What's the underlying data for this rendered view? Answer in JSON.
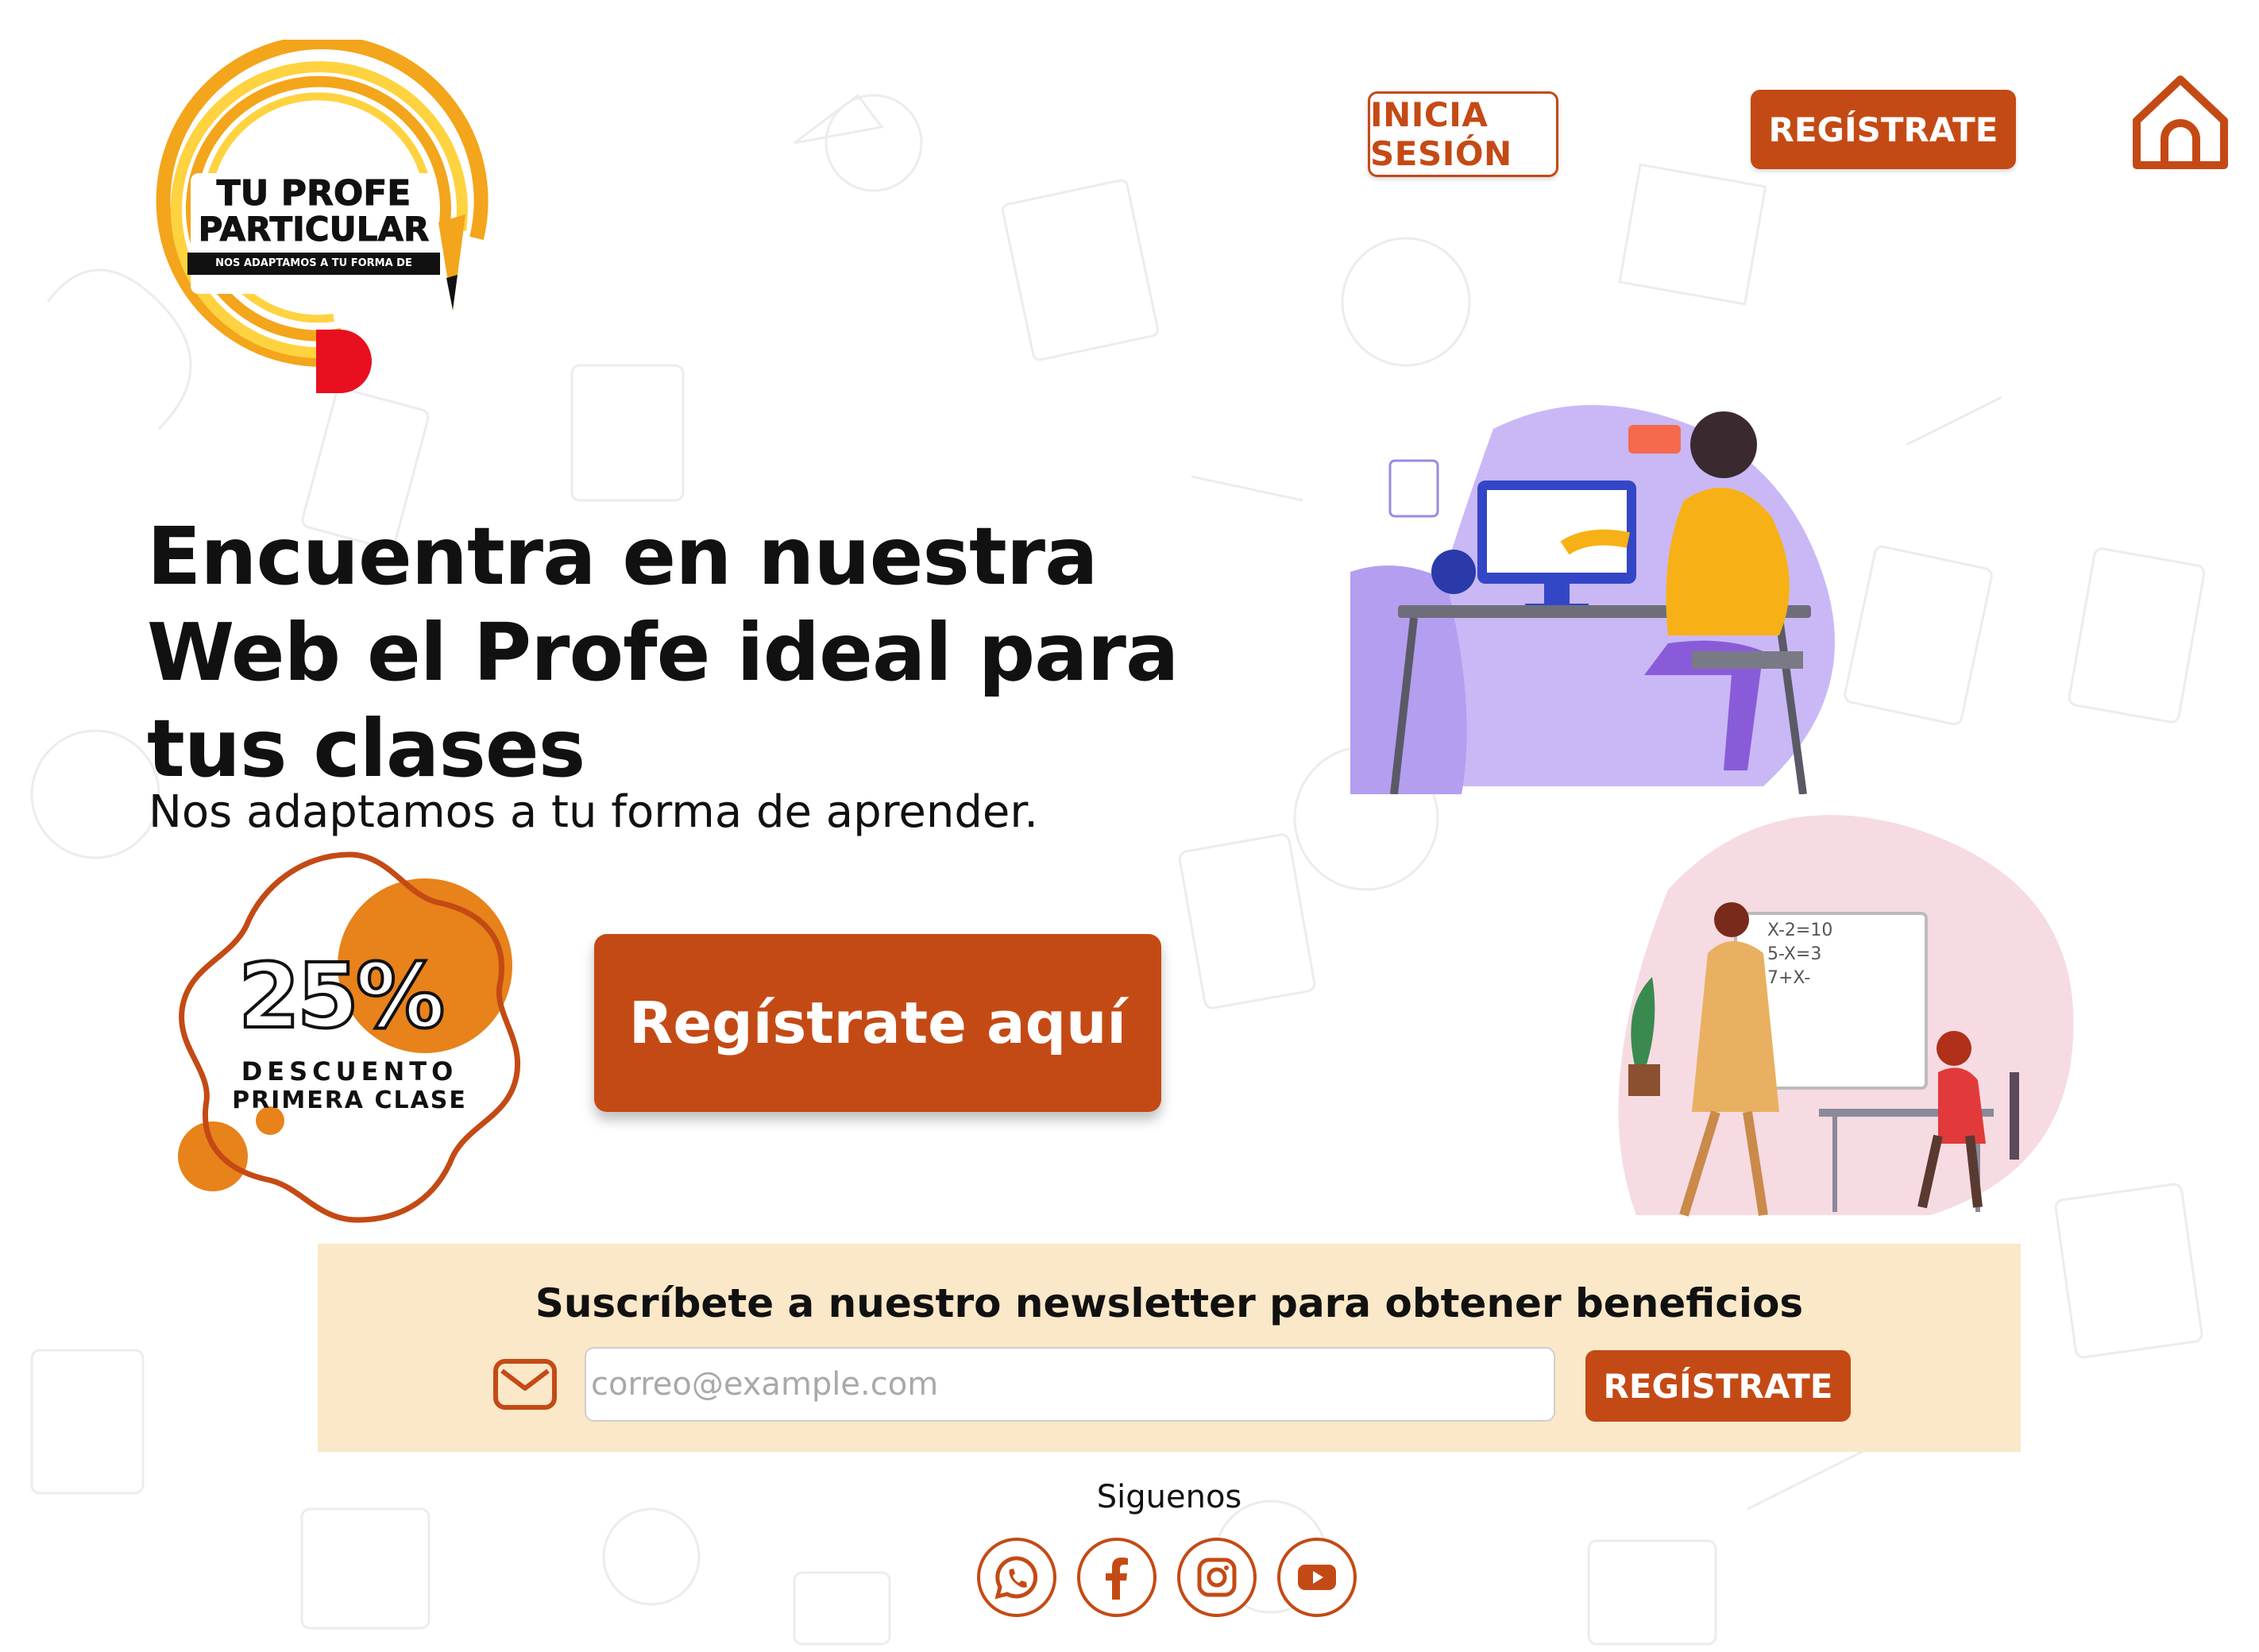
{
  "colors": {
    "brand": "#c44a15",
    "accent_orange": "#e8821a",
    "newsletter_bg": "#fae8c8",
    "text": "#111111"
  },
  "logo": {
    "line1": "TU PROFE",
    "line2": "PARTICULAR",
    "tagline": "NOS ADAPTAMOS A TU FORMA DE APRENDER"
  },
  "header": {
    "login_label": "INICIA SESIÓN",
    "register_label": "REGÍSTRATE",
    "home_icon": "home-icon"
  },
  "hero": {
    "title": "Encuentra en nuestra Web el Profe ideal para tus clases",
    "subtitle": "Nos adaptamos a tu forma de aprender."
  },
  "discount": {
    "value": "25%",
    "label": "DESCUENTO",
    "sublabel": "PRIMERA CLASE"
  },
  "cta": {
    "label": "Regístrate aquí"
  },
  "newsletter": {
    "title": "Suscríbete a nuestro newsletter para obtener beneficios",
    "email_placeholder": "correo@example.com",
    "email_value": "",
    "button_label": "REGÍSTRATE",
    "icon": "mail-icon"
  },
  "social": {
    "title": "Siguenos",
    "icons": [
      "whatsapp-icon",
      "facebook-icon",
      "instagram-icon",
      "youtube-icon"
    ]
  }
}
